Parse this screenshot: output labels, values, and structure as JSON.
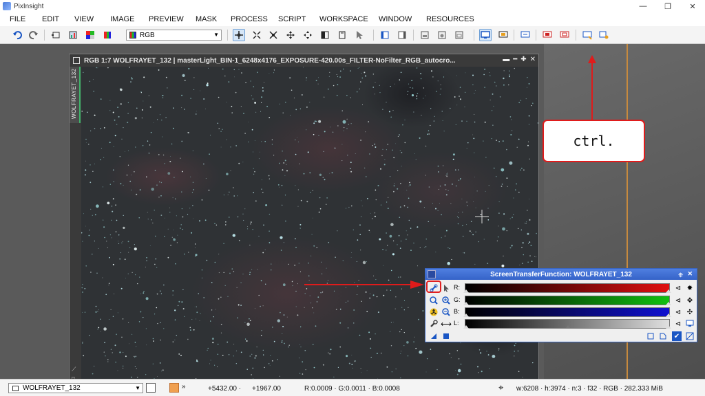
{
  "app": {
    "title": "PixInsight",
    "window_controls": [
      "—",
      "❐",
      "✕"
    ]
  },
  "menu": [
    "FILE",
    "EDIT",
    "VIEW",
    "IMAGE",
    "PREVIEW",
    "MASK",
    "PROCESS",
    "SCRIPT",
    "WORKSPACE",
    "WINDOW",
    "RESOURCES"
  ],
  "toolbar": {
    "channel_select": "RGB"
  },
  "image_window": {
    "title": "RGB 1:7 WOLFRAYET_132 | masterLight_BIN-1_6248x4176_EXPOSURE-420.00s_FILTER-NoFilter_RGB_autocro...",
    "side_tab": "WOLFRAYET_132"
  },
  "stf": {
    "title": "ScreenTransferFunction: WOLFRAYET_132",
    "channels": [
      {
        "label": "R:",
        "color": "#e01010"
      },
      {
        "label": "G:",
        "color": "#10c010"
      },
      {
        "label": "B:",
        "color": "#1010d0"
      },
      {
        "label": "L:",
        "color": "#d8d8d8"
      }
    ]
  },
  "annotation": {
    "text": "ctrl."
  },
  "status": {
    "view": "WOLFRAYET_132",
    "x": "+5432.00 ·",
    "y": "+1967.00",
    "rgb": "R:0.0009 · G:0.0011 · B:0.0008",
    "info": "w:6208 · h:3974 · n:3 · f32 · RGB · 282.333 MiB"
  }
}
